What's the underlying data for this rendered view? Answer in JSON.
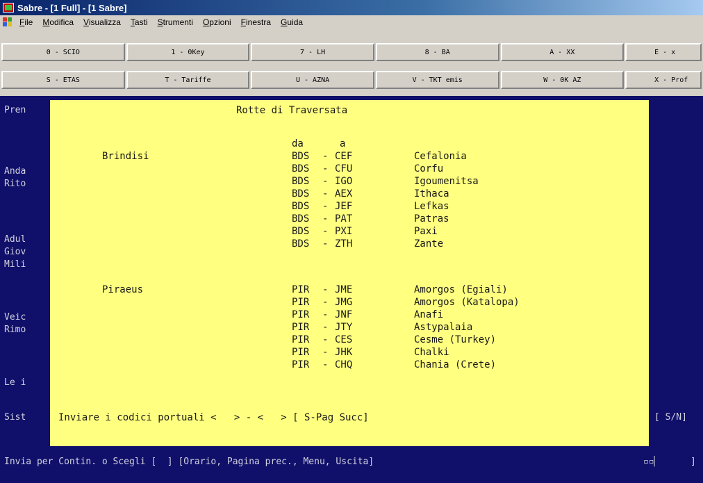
{
  "window": {
    "title": "Sabre - [1 Full] - [1 Sabre]"
  },
  "menu": [
    "File",
    "Modifica",
    "Visualizza",
    "Tasti",
    "Strumenti",
    "Opzioni",
    "Finestra",
    "Guida"
  ],
  "fkeys": {
    "row1": [
      "0 - SCIO",
      "1 - 0Key",
      "7 - LH",
      "8 - BA",
      "A - XX",
      "E - x"
    ],
    "row2": [
      "S - ETAS",
      "T - Tariffe",
      "U - AZNA",
      "V - TKT emis",
      "W - 0K AZ",
      "X - Prof"
    ]
  },
  "terminal": {
    "side_labels": [
      "Pren",
      "Anda",
      "Rito",
      "Adul",
      "Giov",
      "Mili",
      "Veic",
      "Rimo",
      "Le i",
      "Sist"
    ],
    "title": "Rotte di Traversata",
    "col_da": "da",
    "col_a": "a",
    "groups": [
      "Brindisi",
      "Piraeus"
    ],
    "routes": [
      {
        "from": "BDS",
        "dash": "-",
        "to": "CEF",
        "name": "Cefalonia"
      },
      {
        "from": "BDS",
        "dash": "-",
        "to": "CFU",
        "name": "Corfu"
      },
      {
        "from": "BDS",
        "dash": "-",
        "to": "IGO",
        "name": "Igoumenitsa"
      },
      {
        "from": "BDS",
        "dash": "-",
        "to": "AEX",
        "name": "Ithaca"
      },
      {
        "from": "BDS",
        "dash": "-",
        "to": "JEF",
        "name": "Lefkas"
      },
      {
        "from": "BDS",
        "dash": "-",
        "to": "PAT",
        "name": "Patras"
      },
      {
        "from": "BDS",
        "dash": "-",
        "to": "PXI",
        "name": "Paxi"
      },
      {
        "from": "BDS",
        "dash": "-",
        "to": "ZTH",
        "name": "Zante"
      },
      {
        "from": "PIR",
        "dash": "-",
        "to": "JME",
        "name": "Amorgos (Egiali)"
      },
      {
        "from": "PIR",
        "dash": "-",
        "to": "JMG",
        "name": "Amorgos (Katalopa)"
      },
      {
        "from": "PIR",
        "dash": "-",
        "to": "JNF",
        "name": "Anafi"
      },
      {
        "from": "PIR",
        "dash": "-",
        "to": "JTY",
        "name": "Astypalaia"
      },
      {
        "from": "PIR",
        "dash": "-",
        "to": "CES",
        "name": "Cesme (Turkey)"
      },
      {
        "from": "PIR",
        "dash": "-",
        "to": "JHK",
        "name": "Chalki"
      },
      {
        "from": "PIR",
        "dash": "-",
        "to": "CHQ",
        "name": "Chania (Crete)"
      }
    ],
    "prompt": "Inviare i codici portuali <   > - <   > [ S-Pag Succ]",
    "sn": "[ S/N]",
    "status_line": "Invia per Contin. o Scegli [  ] [Orario, Pagina prec., Menu, Uscita]",
    "status_end": "]"
  }
}
